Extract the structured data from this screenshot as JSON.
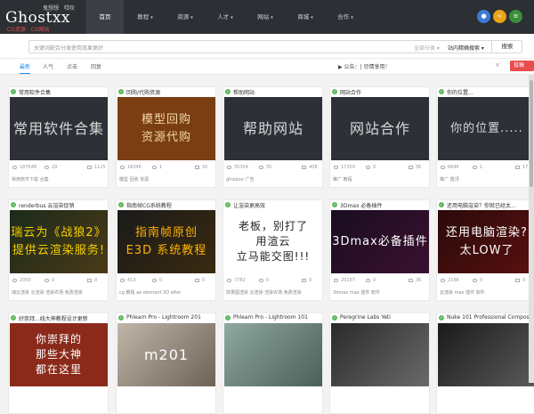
{
  "logo": {
    "text": "Ghostxx",
    "cn1": "鬼想想",
    "cn2": "哎叹",
    "sub": "CG资源 · CG网站"
  },
  "nav": [
    {
      "label": "首页",
      "arrow": ""
    },
    {
      "label": "教程",
      "arrow": "▾"
    },
    {
      "label": "资源",
      "arrow": "▾"
    },
    {
      "label": "人才",
      "arrow": "▾"
    },
    {
      "label": "网站",
      "arrow": "▾"
    },
    {
      "label": "商城",
      "arrow": "▾"
    },
    {
      "label": "合作",
      "arrow": "▾"
    }
  ],
  "toolbar": {
    "bell": "●",
    "share": "<",
    "user": "≡"
  },
  "search": {
    "placeholder": "关键词配合分类使用效果更好",
    "category": "全部分类 ▾",
    "mode": "站内精确搜索 ▾",
    "button": "搜索"
  },
  "tabs": [
    "最新",
    "人气",
    "点击",
    "回复"
  ],
  "notice": {
    "text": "▶ 公告：| 尽情享用！",
    "close": "×",
    "btn": "投稿"
  },
  "cards": [
    {
      "title": "常用软件合集",
      "banner": "常用软件合集",
      "views": "187648",
      "comments": "29",
      "likes": "1125",
      "tags": "常用软件下载  合集"
    },
    {
      "title": "回购/代购资源",
      "banner": "模型回购\n资源代购",
      "views": "18346",
      "comments": "1",
      "likes": "50",
      "tags": "模型  回收  资源"
    },
    {
      "title": "帮助网站",
      "banner": "帮助网站",
      "views": "35304",
      "comments": "35",
      "likes": "408",
      "tags": "ghostxx  广告"
    },
    {
      "title": "网站合作",
      "banner": "网站合作",
      "views": "17359",
      "comments": "0",
      "likes": "36",
      "tags": "推广  教程"
    },
    {
      "title": "你的位置...",
      "banner": "你的位置.....",
      "views": "6846",
      "comments": "1",
      "likes": "17",
      "tags": "推广  置顶"
    },
    {
      "title": "renderbus 云渲染促销",
      "banner": "瑞云为《战狼2》\n提供云渲染服务!",
      "views": "2050",
      "comments": "0",
      "likes": "0",
      "tags": "瑞云渲染  云渲染  渲染农场  免费渲染"
    },
    {
      "title": "指南帧CG系统教程",
      "banner": "指南帧原创\nE3D 系统教程",
      "views": "413",
      "comments": "0",
      "likes": "0",
      "tags": "cg  教程  ae  element  3D  after"
    },
    {
      "title": "让渲染更高效",
      "banner": "老板，别打了\n用渲云\n立马能交图!!!",
      "views": "7782",
      "comments": "0",
      "likes": "0",
      "tags": "效果图渲染  云渲染  渲染农场  免费渲染"
    },
    {
      "title": "3Dmax 必备插件",
      "banner": "3Dmax必备插件",
      "views": "20197",
      "comments": "0",
      "likes": "36",
      "tags": "3dmax  max  插件  软件"
    },
    {
      "title": "还用电脑渲染？你就已经太...",
      "banner": "还用电脑渲染?\n太LOW了",
      "views": "2166",
      "comments": "0",
      "likes": "0",
      "tags": "云渲染  max  插件  软件"
    },
    {
      "title": "好崇拜...线大神教程设计更新",
      "banner": "你崇拜的\n那些大神\n都在这里",
      "views": "",
      "comments": "",
      "likes": "",
      "tags": ""
    },
    {
      "title": "Phlearn Pro - Lightroom 201",
      "banner": "m201",
      "views": "",
      "comments": "",
      "likes": "",
      "tags": ""
    },
    {
      "title": "Phlearn Pro - Lightroom 101",
      "banner": "",
      "views": "",
      "comments": "",
      "likes": "",
      "tags": ""
    },
    {
      "title": "Peregrine Labs Yeti",
      "banner": "",
      "views": "",
      "comments": "",
      "likes": "",
      "tags": ""
    },
    {
      "title": "Nuke 101 Professional Compositi...",
      "banner": "",
      "views": "",
      "comments": "",
      "likes": "",
      "tags": ""
    }
  ]
}
